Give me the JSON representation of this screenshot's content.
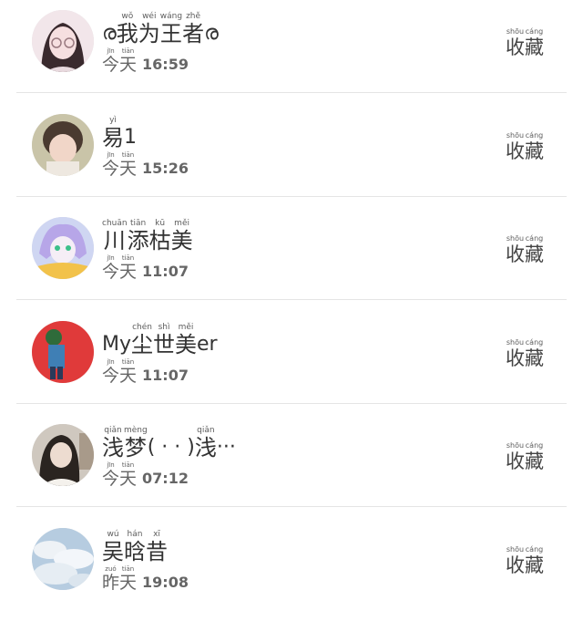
{
  "users": [
    {
      "name": [
        {
          "t": "ര"
        },
        {
          "t": "我",
          "p": "wǒ"
        },
        {
          "t": "为",
          "p": "wéi"
        },
        {
          "t": "王",
          "p": "wáng"
        },
        {
          "t": "者",
          "p": "zhě"
        },
        {
          "t": "ര"
        }
      ],
      "day": [
        {
          "t": "今",
          "p": "jīn"
        },
        {
          "t": "天",
          "p": "tiān"
        }
      ],
      "time": "16:59",
      "avatar": "avatar-girl-glasses"
    },
    {
      "name": [
        {
          "t": "易",
          "p": "yì"
        },
        {
          "t": "1"
        }
      ],
      "day": [
        {
          "t": "今",
          "p": "jīn"
        },
        {
          "t": "天",
          "p": "tiān"
        }
      ],
      "time": "15:26",
      "avatar": "avatar-child"
    },
    {
      "name": [
        {
          "t": "川",
          "p": "chuān"
        },
        {
          "t": "添",
          "p": "tiān"
        },
        {
          "t": "枯",
          "p": "kū"
        },
        {
          "t": "美",
          "p": "měi"
        }
      ],
      "day": [
        {
          "t": "今",
          "p": "jīn"
        },
        {
          "t": "天",
          "p": "tiān"
        }
      ],
      "time": "11:07",
      "avatar": "avatar-anime"
    },
    {
      "name": [
        {
          "t": "My"
        },
        {
          "t": "尘",
          "p": "chén"
        },
        {
          "t": "世",
          "p": "shì"
        },
        {
          "t": "美",
          "p": "měi"
        },
        {
          "t": "er"
        }
      ],
      "day": [
        {
          "t": "今",
          "p": "jīn"
        },
        {
          "t": "天",
          "p": "tiān"
        }
      ],
      "time": "11:07",
      "avatar": "avatar-red-figure"
    },
    {
      "name": [
        {
          "t": "浅",
          "p": "qiǎn"
        },
        {
          "t": "梦",
          "p": "mèng"
        },
        {
          "t": "(  ·       · )"
        },
        {
          "t": "浅",
          "p": "qiǎn"
        },
        {
          "t": "···"
        }
      ],
      "day": [
        {
          "t": "今",
          "p": "jīn"
        },
        {
          "t": "天",
          "p": "tiān"
        }
      ],
      "time": "07:12",
      "avatar": "avatar-girl-dark"
    },
    {
      "name": [
        {
          "t": "吴",
          "p": "wú"
        },
        {
          "t": "晗",
          "p": "hán"
        },
        {
          "t": "昔",
          "p": "xī"
        }
      ],
      "day": [
        {
          "t": "昨",
          "p": "zuó"
        },
        {
          "t": "天",
          "p": "tiān"
        }
      ],
      "time": "19:08",
      "avatar": "avatar-clouds"
    }
  ],
  "favorite": [
    {
      "t": "收",
      "p": "shōu"
    },
    {
      "t": "藏",
      "p": "cáng"
    }
  ],
  "colors": {
    "divider": "#e5e5e5",
    "text": "#333333",
    "muted": "#666666"
  }
}
